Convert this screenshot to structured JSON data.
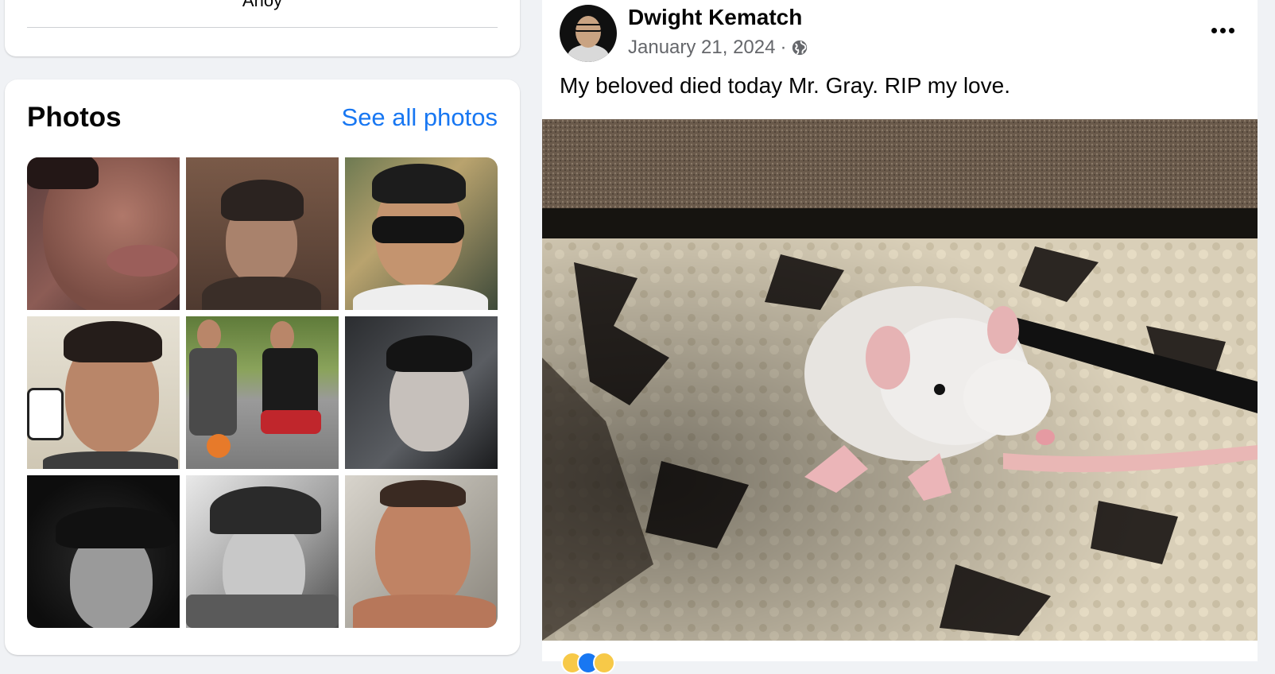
{
  "intro": {
    "cut_text": "Ahoy"
  },
  "photos": {
    "title": "Photos",
    "see_all": "See all photos",
    "tiles": [
      {
        "name": "photo-closeup-face"
      },
      {
        "name": "photo-beanie-selfie"
      },
      {
        "name": "photo-sunglasses-selfie"
      },
      {
        "name": "photo-office-selfie"
      },
      {
        "name": "photo-two-men-street"
      },
      {
        "name": "photo-dark-smile-selfie"
      },
      {
        "name": "photo-cap-bw-selfie"
      },
      {
        "name": "photo-hardhat-bw-selfie"
      },
      {
        "name": "photo-shirtless-selfie"
      }
    ]
  },
  "post": {
    "author": "Dwight Kematch",
    "date": "January 21, 2024",
    "separator": "·",
    "privacy_icon": "globe-icon",
    "menu_icon": "more-options-icon",
    "text": "My beloved died today Mr. Gray. RIP my love.",
    "image_subject": "white rat on leash standing on patterned carpet"
  },
  "colors": {
    "link": "#1877f2",
    "page_bg": "#f0f2f5",
    "meta_text": "#65676b"
  }
}
